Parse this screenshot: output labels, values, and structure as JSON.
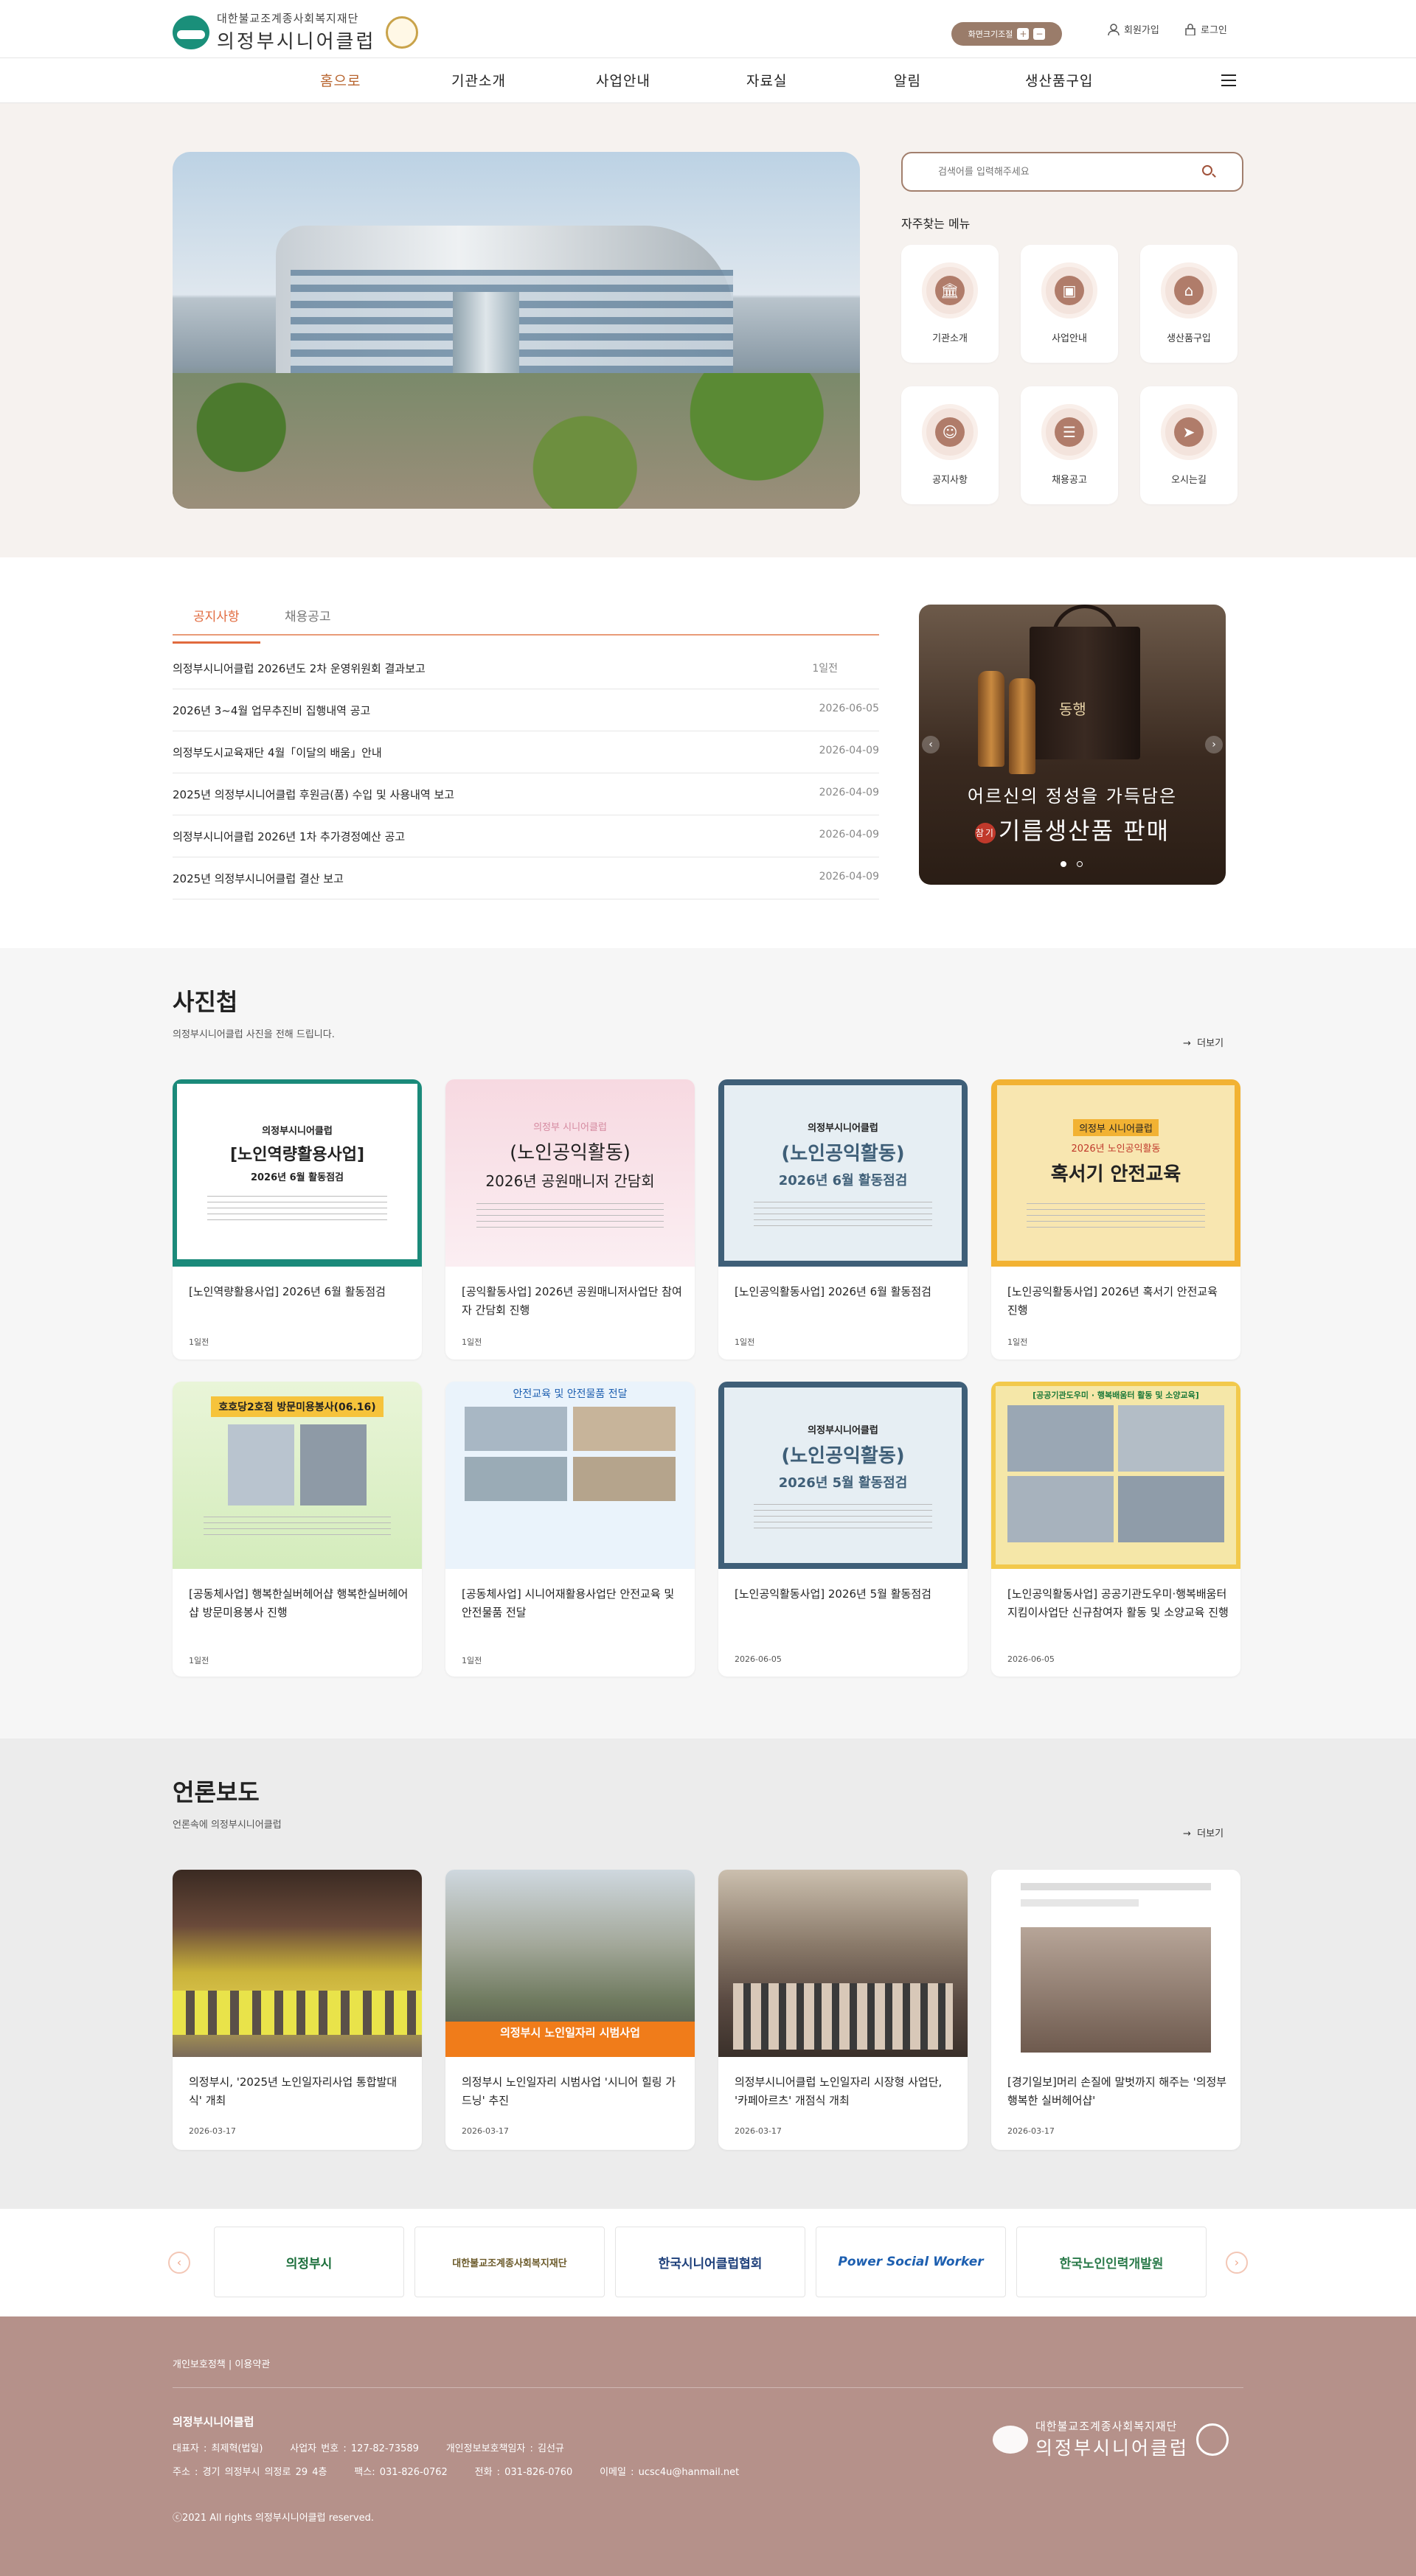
{
  "header": {
    "logo_line1": "대한불교조계종사회복지재단",
    "logo_line2": "의정부시니어클럽",
    "font_size_label": "화면크기조절",
    "font_plus": "+",
    "font_minus": "−",
    "join_label": "회원가입",
    "login_label": "로그인"
  },
  "nav": {
    "items": [
      "홈으로",
      "기관소개",
      "사업안내",
      "자료실",
      "알림",
      "생산품구입"
    ],
    "active_color": "#b8652f"
  },
  "search": {
    "placeholder": "검색어를 입력해주세요"
  },
  "quick_menu": {
    "title": "자주찾는 메뉴",
    "items": [
      {
        "label": "기관소개",
        "icon": "building-icon",
        "glyph": "🏛"
      },
      {
        "label": "사업안내",
        "icon": "monitor-icon",
        "glyph": "▣"
      },
      {
        "label": "생산품구입",
        "icon": "shop-icon",
        "glyph": "⌂"
      },
      {
        "label": "공지사항",
        "icon": "person-speaker-icon",
        "glyph": "☺"
      },
      {
        "label": "채용공고",
        "icon": "clipboard-icon",
        "glyph": "☰"
      },
      {
        "label": "오시는길",
        "icon": "paper-plane-icon",
        "glyph": "➤"
      }
    ]
  },
  "notice": {
    "tabs": [
      "공지사항",
      "채용공고"
    ],
    "rows": [
      {
        "title": "의정부시니어클럽 2026년도 2차 운영위원회 결과보고",
        "date": "1일전"
      },
      {
        "title": "2026년 3~4월 업무추진비 집행내역 공고",
        "date": "2026-06-05"
      },
      {
        "title": "의정부도시교육재단 4월「이달의 배움」안내",
        "date": "2026-04-09"
      },
      {
        "title": "2025년 의정부시니어클럽 후원금(품) 수입 및 사용내역 보고",
        "date": "2026-04-09"
      },
      {
        "title": "의정부시니어클럽 2026년 1차 추가경정예산 공고",
        "date": "2026-04-09"
      },
      {
        "title": "2025년 의정부시니어클럽 결산 보고",
        "date": "2026-04-09"
      }
    ]
  },
  "banner": {
    "product_label": "동행",
    "line1": "어르신의 정성을 가득담은",
    "line2": "기름생산품 판매",
    "badge": "참기"
  },
  "gallery": {
    "title": "사진첩",
    "subtitle": "의정부시니어클럽 사진을 전해 드립니다.",
    "more": "더보기",
    "cards": [
      {
        "title": "[노인역량활용사업] 2026년 6월 활동점검",
        "date": "1일전",
        "thumb_top": "의정부시니어클럽",
        "thumb_big": "[노인역량활용사업]",
        "thumb_sub": "2026년 6월 활동점검"
      },
      {
        "title": "[공익활동사업] 2026년 공원매니저사업단 참여자 간담회 진행",
        "date": "1일전",
        "thumb_top": "의정부 시니어클럽",
        "thumb_big": "(노인공익활동)",
        "thumb_sub": "2026년 공원매니저 간담회"
      },
      {
        "title": "[노인공익활동사업] 2026년 6월 활동점검",
        "date": "1일전",
        "thumb_top": "의정부시니어클럽",
        "thumb_big": "(노인공익활동)",
        "thumb_sub": "2026년 6월 활동점검"
      },
      {
        "title": "[노인공익활동사업] 2026년 혹서기 안전교육 진행",
        "date": "1일전",
        "thumb_top": "의정부 시니어클럽",
        "thumb_big": "혹서기 안전교육",
        "thumb_sub": "2026년 노인공익활동"
      },
      {
        "title": "[공동체사업] 행복한실버헤어샵 행복한실버헤어샵 방문미용봉사 진행",
        "date": "1일전",
        "thumb_top": "",
        "thumb_big": "호호당2호점 방문미용봉사(06.16)",
        "thumb_sub": ""
      },
      {
        "title": "[공동체사업] 시니어재활용사업단 안전교육 및 안전물품 전달",
        "date": "1일전",
        "thumb_top": "",
        "thumb_big": "안전교육 및 안전물품 전달",
        "thumb_sub": ""
      },
      {
        "title": "[노인공익활동사업] 2026년 5월 활동점검",
        "date": "2026-06-05",
        "thumb_top": "의정부시니어클럽",
        "thumb_big": "(노인공익활동)",
        "thumb_sub": "2026년 5월 활동점검"
      },
      {
        "title": "[노인공익활동사업] 공공기관도우미·행복배움터지킴이사업단 신규참여자 활동 및 소양교육 진행",
        "date": "2026-06-05",
        "thumb_top": "[공공기관도우미 · 행복배움터 활동 및 소양교육]",
        "thumb_big": "",
        "thumb_sub": ""
      }
    ]
  },
  "press": {
    "title": "언론보도",
    "subtitle": "언론속에 의정부시니어클럽",
    "more": "더보기",
    "cards": [
      {
        "title": "의정부시, '2025년 노인일자리사업 통합발대식' 개최",
        "date": "2026-03-17",
        "thumb_text": ""
      },
      {
        "title": "의정부시 노인일자리 시범사업 '시니어 힐링 가드닝' 추진",
        "date": "2026-03-17",
        "thumb_text": "의정부시 노인일자리 시범사업"
      },
      {
        "title": "의정부시니어클럽 노인일자리 시장형 사업단, '카페아르츠' 개점식 개최",
        "date": "2026-03-17",
        "thumb_text": ""
      },
      {
        "title": "[경기일보]머리 손질에 말벗까지 해주는 '의정부 행복한 실버헤어샵'",
        "date": "2026-03-17",
        "thumb_text": ""
      }
    ]
  },
  "partners": [
    {
      "name": "의정부시",
      "color": "#1a6e3a"
    },
    {
      "name": "대한불교조계종사회복지재단",
      "color": "#6b5a2a"
    },
    {
      "name": "한국시니어클럽협회",
      "color": "#1d3f7a"
    },
    {
      "name": "Power Social Worker",
      "color": "#1d5fb0"
    },
    {
      "name": "한국노인인력개발원",
      "color": "#2a7a4a"
    }
  ],
  "footer": {
    "links": "개인보호정책 | 이용약관",
    "org_name": "의정부시니어클럽",
    "info1": "대표자 : 최제혁(법일)      사업자 번호 : 127-82-73589      개인정보보호책임자 : 김선규",
    "info2": "주소 : 경기 의정부시 의정로 29 4층      팩스: 031-826-0762      전화 : 031-826-0760      이메일 : ucsc4u@hanmail.net",
    "copyright": "ⓒ2021 All rights 의정부시니어클럽 reserved.",
    "logo_line1": "대한불교조계종사회복지재단",
    "logo_line2": "의정부시니어클럽"
  }
}
